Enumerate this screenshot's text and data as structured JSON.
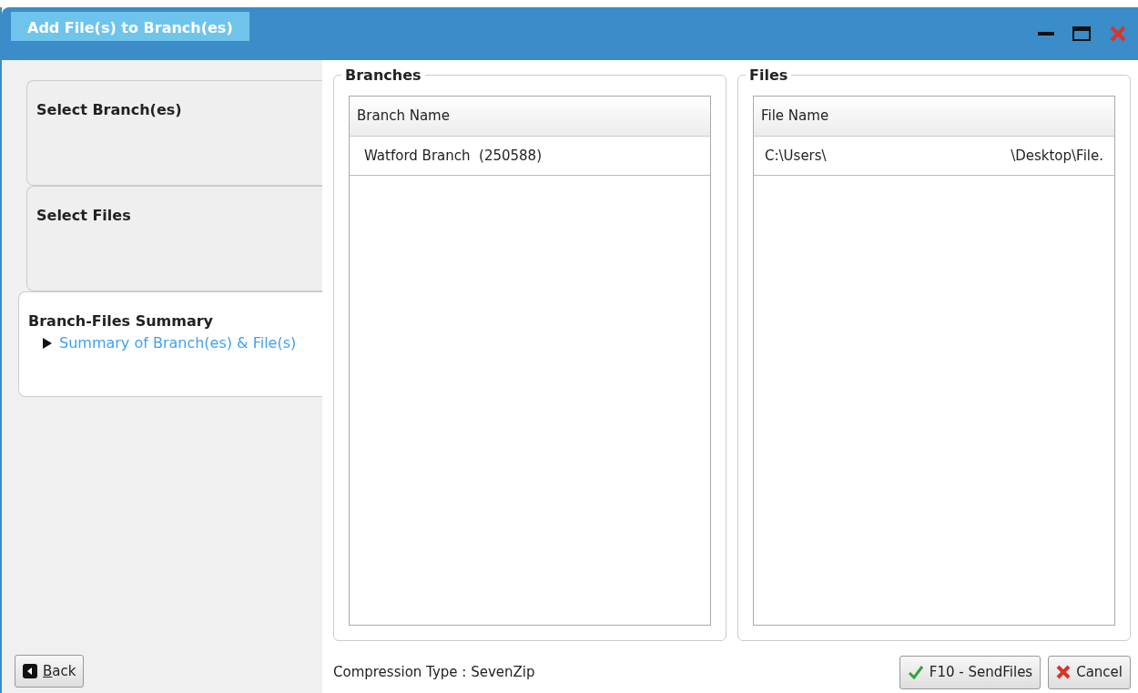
{
  "window": {
    "title": "Add File(s) to Branch(es)"
  },
  "steps": [
    {
      "title": "Select Branch(es)",
      "selected": false
    },
    {
      "title": "Select Files",
      "selected": false
    },
    {
      "title": "Branch-Files Summary",
      "selected": true,
      "links": [
        "Summary of Branch(es) & File(s)"
      ]
    }
  ],
  "branches": {
    "title": "Branches",
    "column": "Branch Name",
    "rows": [
      {
        "name": "Watford Branch",
        "code": "(250588)"
      }
    ]
  },
  "files": {
    "title": "Files",
    "column": "File Name",
    "rows": [
      {
        "path_start": "C:\\Users\\",
        "path_end": "\\Desktop\\File."
      }
    ]
  },
  "compression": "Compression Type : SevenZip",
  "buttons": [
    {
      "kind": "back",
      "access_key": "B",
      "label_rest": "ack"
    },
    {
      "kind": "send",
      "label": "F10 - SendFiles"
    },
    {
      "kind": "cancel",
      "label": "Cancel"
    }
  ]
}
